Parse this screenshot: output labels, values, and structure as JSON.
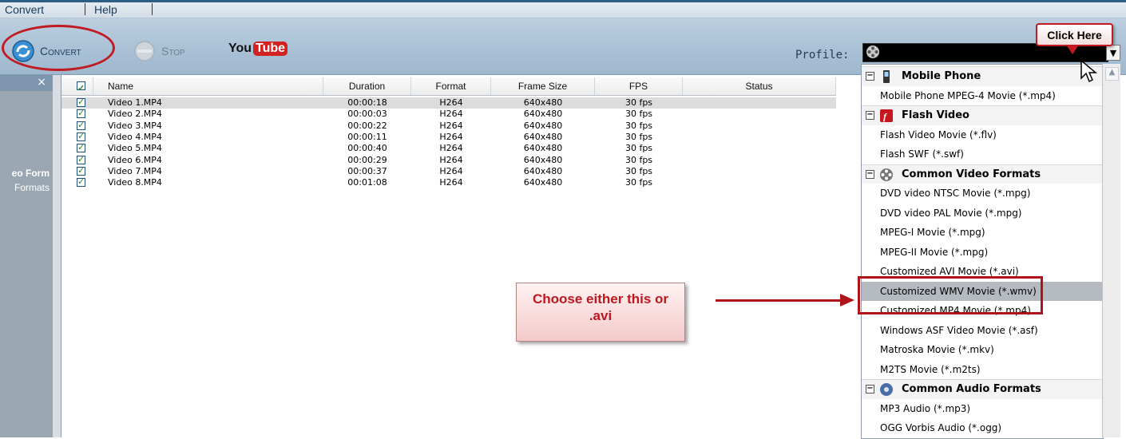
{
  "menu": {
    "items": [
      "Convert",
      "Help"
    ]
  },
  "toolbar": {
    "convert_label": "Convert",
    "stop_label": "Stop",
    "youtube_label_you": "You",
    "youtube_label_tube": "Tube",
    "profile_label": "Profile:"
  },
  "left_panel": {
    "line1": "eo Form",
    "line2": "Formats",
    "close": "×"
  },
  "table": {
    "headers": [
      "Name",
      "Duration",
      "Format",
      "Frame Size",
      "FPS",
      "Status"
    ],
    "rows": [
      {
        "name": "Video 1.MP4",
        "duration": "00:00:18",
        "format": "H264",
        "frame": "640x480",
        "fps": "30 fps"
      },
      {
        "name": "Video 2.MP4",
        "duration": "00:00:03",
        "format": "H264",
        "frame": "640x480",
        "fps": "30 fps"
      },
      {
        "name": "Video 3.MP4",
        "duration": "00:00:22",
        "format": "H264",
        "frame": "640x480",
        "fps": "30 fps"
      },
      {
        "name": "Video 4.MP4",
        "duration": "00:00:11",
        "format": "H264",
        "frame": "640x480",
        "fps": "30 fps"
      },
      {
        "name": "Video 5.MP4",
        "duration": "00:00:40",
        "format": "H264",
        "frame": "640x480",
        "fps": "30 fps"
      },
      {
        "name": "Video 6.MP4",
        "duration": "00:00:29",
        "format": "H264",
        "frame": "640x480",
        "fps": "30 fps"
      },
      {
        "name": "Video 7.MP4",
        "duration": "00:00:37",
        "format": "H264",
        "frame": "640x480",
        "fps": "30 fps"
      },
      {
        "name": "Video 8.MP4",
        "duration": "00:01:08",
        "format": "H264",
        "frame": "640x480",
        "fps": "30 fps"
      }
    ]
  },
  "dropdown": {
    "groups": {
      "mobile": "Mobile Phone",
      "flash": "Flash Video",
      "video": "Common Video Formats",
      "audio": "Common Audio Formats"
    },
    "items": {
      "mp4_mobile": "Mobile Phone MPEG-4 Movie (*.mp4)",
      "flv": "Flash Video Movie (*.flv)",
      "swf": "Flash SWF (*.swf)",
      "dvd_ntsc": "DVD video NTSC Movie (*.mpg)",
      "dvd_pal": "DVD video PAL Movie (*.mpg)",
      "mpeg1": "MPEG-I Movie (*.mpg)",
      "mpeg2": "MPEG-II Movie (*.mpg)",
      "avi": "Customized AVI Movie (*.avi)",
      "wmv": "Customized WMV Movie (*.wmv)",
      "mp4": "Customized MP4 Movie (*.mp4)",
      "asf": "Windows ASF Video Movie (*.asf)",
      "mkv": "Matroska Movie (*.mkv)",
      "m2ts": "M2TS Movie (*.m2ts)",
      "mp3": "MP3 Audio (*.mp3)",
      "ogg": "OGG Vorbis Audio (*.ogg)"
    }
  },
  "annotations": {
    "click_here": "Click Here",
    "choose_line1": "Choose either this or",
    "choose_line2": ".avi"
  }
}
